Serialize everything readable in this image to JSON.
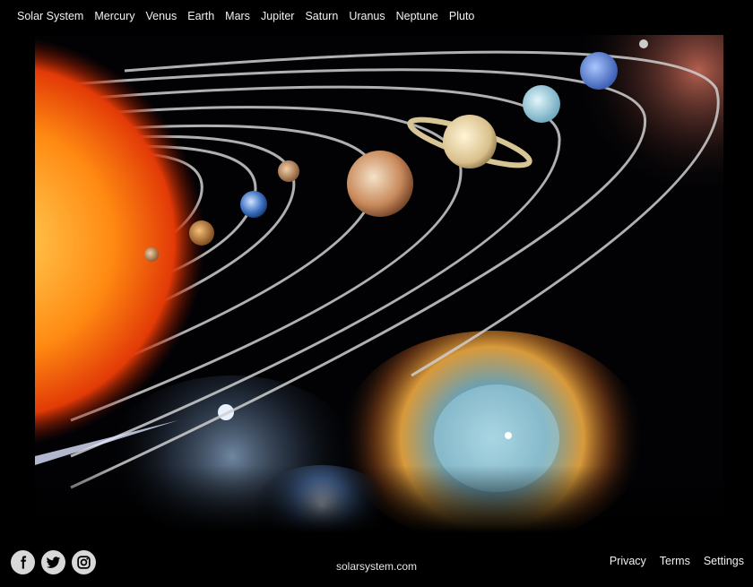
{
  "nav": {
    "items": [
      {
        "label": "Solar System"
      },
      {
        "label": "Mercury"
      },
      {
        "label": "Venus"
      },
      {
        "label": "Earth"
      },
      {
        "label": "Mars"
      },
      {
        "label": "Jupiter"
      },
      {
        "label": "Saturn"
      },
      {
        "label": "Uranus"
      },
      {
        "label": "Neptune"
      },
      {
        "label": "Pluto"
      }
    ]
  },
  "footer": {
    "social": [
      {
        "icon": "facebook-icon"
      },
      {
        "icon": "twitter-icon"
      },
      {
        "icon": "instagram-icon"
      }
    ],
    "domain": "solarsystem.com",
    "links": [
      {
        "label": "Privacy"
      },
      {
        "label": "Terms"
      },
      {
        "label": "Settings"
      }
    ]
  },
  "colors": {
    "background": "#000000",
    "nav_text": "#f2f2f2",
    "icon_bg": "#d8d8d8",
    "icon_fg": "#000000"
  }
}
